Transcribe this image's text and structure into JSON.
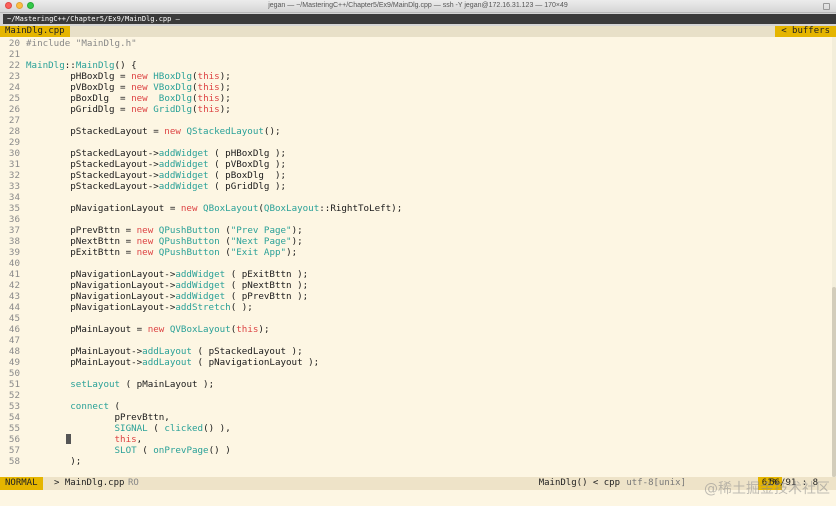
{
  "window": {
    "title": "jegan — ~/MasteringC++/Chapter5/Ex9/MainDlg.cpp — ssh -Y jegan@172.16.31.123 — 170×49"
  },
  "terminal_tabs": [
    "~/MasteringC++/Chapter5/Ex9/MainDlg.cpp — ssh -Y jegan@172.18.31.133",
    "",
    ""
  ],
  "vim": {
    "active_tab": "MainDlg.cpp",
    "buffers_label": "< buffers"
  },
  "code_lines": [
    {
      "n": "20",
      "t": "#include \"MainDlg.h\""
    },
    {
      "n": "21",
      "t": ""
    },
    {
      "n": "22",
      "t": "MainDlg::MainDlg() {"
    },
    {
      "n": "23",
      "t": "        pHBoxDlg = new HBoxDlg(this);"
    },
    {
      "n": "24",
      "t": "        pVBoxDlg = new VBoxDlg(this);"
    },
    {
      "n": "25",
      "t": "        pBoxDlg  = new  BoxDlg(this);"
    },
    {
      "n": "26",
      "t": "        pGridDlg = new GridDlg(this);"
    },
    {
      "n": "27",
      "t": ""
    },
    {
      "n": "28",
      "t": "        pStackedLayout = new QStackedLayout();"
    },
    {
      "n": "29",
      "t": ""
    },
    {
      "n": "30",
      "t": "        pStackedLayout->addWidget ( pHBoxDlg );"
    },
    {
      "n": "31",
      "t": "        pStackedLayout->addWidget ( pVBoxDlg );"
    },
    {
      "n": "32",
      "t": "        pStackedLayout->addWidget ( pBoxDlg  );"
    },
    {
      "n": "33",
      "t": "        pStackedLayout->addWidget ( pGridDlg );"
    },
    {
      "n": "34",
      "t": ""
    },
    {
      "n": "35",
      "t": "        pNavigationLayout = new QBoxLayout(QBoxLayout::RightToLeft);"
    },
    {
      "n": "36",
      "t": ""
    },
    {
      "n": "37",
      "t": "        pPrevBttn = new QPushButton (\"Prev Page\");"
    },
    {
      "n": "38",
      "t": "        pNextBttn = new QPushButton (\"Next Page\");"
    },
    {
      "n": "39",
      "t": "        pExitBttn = new QPushButton (\"Exit App\");"
    },
    {
      "n": "40",
      "t": ""
    },
    {
      "n": "41",
      "t": "        pNavigationLayout->addWidget ( pExitBttn );"
    },
    {
      "n": "42",
      "t": "        pNavigationLayout->addWidget ( pNextBttn );"
    },
    {
      "n": "43",
      "t": "        pNavigationLayout->addWidget ( pPrevBttn );"
    },
    {
      "n": "44",
      "t": "        pNavigationLayout->addStretch( );"
    },
    {
      "n": "45",
      "t": ""
    },
    {
      "n": "46",
      "t": "        pMainLayout = new QVBoxLayout(this);"
    },
    {
      "n": "47",
      "t": ""
    },
    {
      "n": "48",
      "t": "        pMainLayout->addLayout ( pStackedLayout );"
    },
    {
      "n": "49",
      "t": "        pMainLayout->addLayout ( pNavigationLayout );"
    },
    {
      "n": "50",
      "t": ""
    },
    {
      "n": "51",
      "t": "        setLayout ( pMainLayout );"
    },
    {
      "n": "52",
      "t": ""
    },
    {
      "n": "53",
      "t": "        connect ("
    },
    {
      "n": "54",
      "t": "                pPrevBttn,"
    },
    {
      "n": "55",
      "t": "                SIGNAL ( clicked() ),"
    },
    {
      "n": "56",
      "t": "                this,"
    },
    {
      "n": "57",
      "t": "                SLOT ( onPrevPage() )"
    },
    {
      "n": "58",
      "t": "        );"
    }
  ],
  "statusline": {
    "mode": "NORMAL",
    "filename": "> MainDlg.cpp",
    "readonly": "RO",
    "function": "MainDlg() < cpp",
    "encoding": "utf-8[unix]",
    "percent": "61%",
    "position": "56/91 : 8"
  },
  "watermark": "@稀土掘金技术社区",
  "colors": {
    "accent": "#e5b500",
    "editor_bg": "#fdf6e3",
    "keyword": "#dd4444",
    "type": "#2aa198"
  }
}
